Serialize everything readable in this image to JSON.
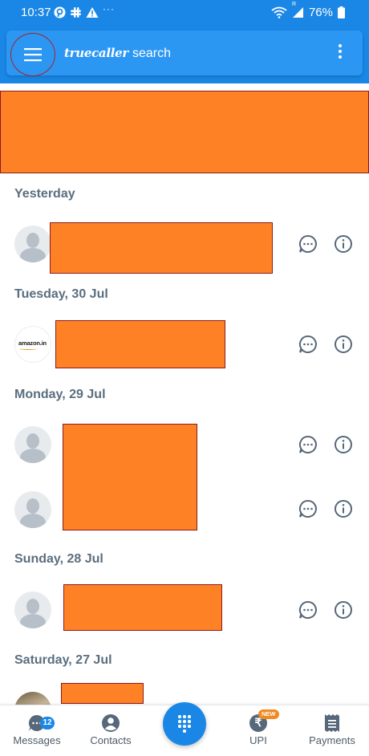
{
  "status_bar": {
    "time": "10:37",
    "left_icons": [
      "pinterest-icon",
      "slack-icon",
      "warning-icon"
    ],
    "overflow_dots": "···",
    "right_icons": [
      "wifi-icon",
      "signal-icon",
      "battery-icon"
    ],
    "signal_tag": "R",
    "battery": "76%"
  },
  "header": {
    "brand_logo": "truecaller",
    "brand_search": "search"
  },
  "sections": [
    {
      "label": "Yesterday"
    },
    {
      "label": "Tuesday, 30 Jul"
    },
    {
      "label": "Monday, 29 Jul"
    },
    {
      "label": "Sunday, 28 Jul"
    },
    {
      "label": "Saturday, 27 Jul"
    }
  ],
  "call_rows": [
    {
      "avatar": "default-avatar"
    },
    {
      "avatar": "amazon-logo",
      "avatar_text": "amazon.in"
    },
    {
      "avatar": "default-avatar"
    },
    {
      "avatar": "default-avatar"
    },
    {
      "avatar": "default-avatar"
    },
    {
      "avatar": "photo-avatar"
    }
  ],
  "bottom_nav": {
    "messages": {
      "label": "Messages",
      "badge": "12"
    },
    "contacts": {
      "label": "Contacts"
    },
    "upi": {
      "label": "UPI",
      "badge": "NEW",
      "symbol": "₹"
    },
    "payments": {
      "label": "Payments"
    }
  },
  "colors": {
    "primary": "#1a87e6",
    "search_bar": "#2c97f3",
    "redaction": "#ff8126",
    "redaction_border": "#8c1b1b",
    "section_text": "#5a6e7f",
    "icon_gray": "#56687a",
    "upi_badge": "#f08a23"
  }
}
